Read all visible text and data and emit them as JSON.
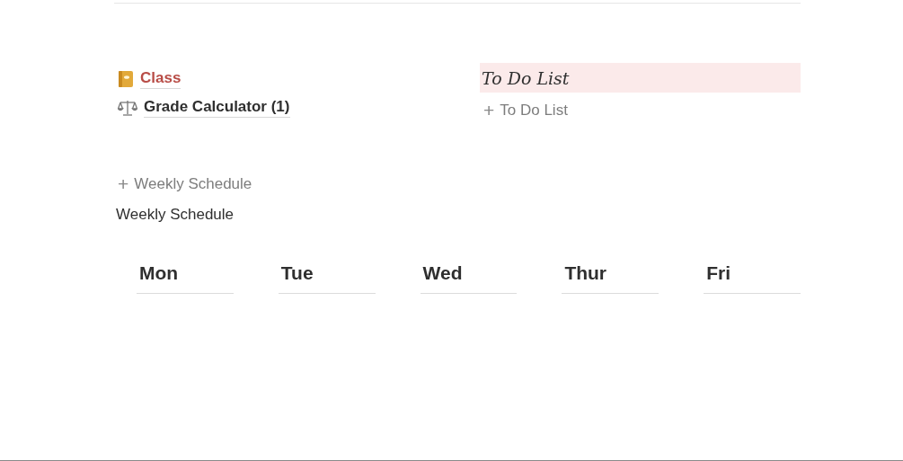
{
  "links": [
    {
      "label": "Class",
      "kind": "notebook",
      "color": "#b84c46"
    },
    {
      "label": "Grade Calculator (1)",
      "kind": "scales",
      "color": "#2f2f2f"
    }
  ],
  "todo": {
    "heading": "To Do List",
    "add_label": "To Do List",
    "add_icon": "+"
  },
  "schedule": {
    "add_icon": "+",
    "add_label": "Weekly Schedule",
    "title": "Weekly Schedule",
    "days": [
      "Mon",
      "Tue",
      "Wed",
      "Thur",
      "Fri"
    ]
  }
}
